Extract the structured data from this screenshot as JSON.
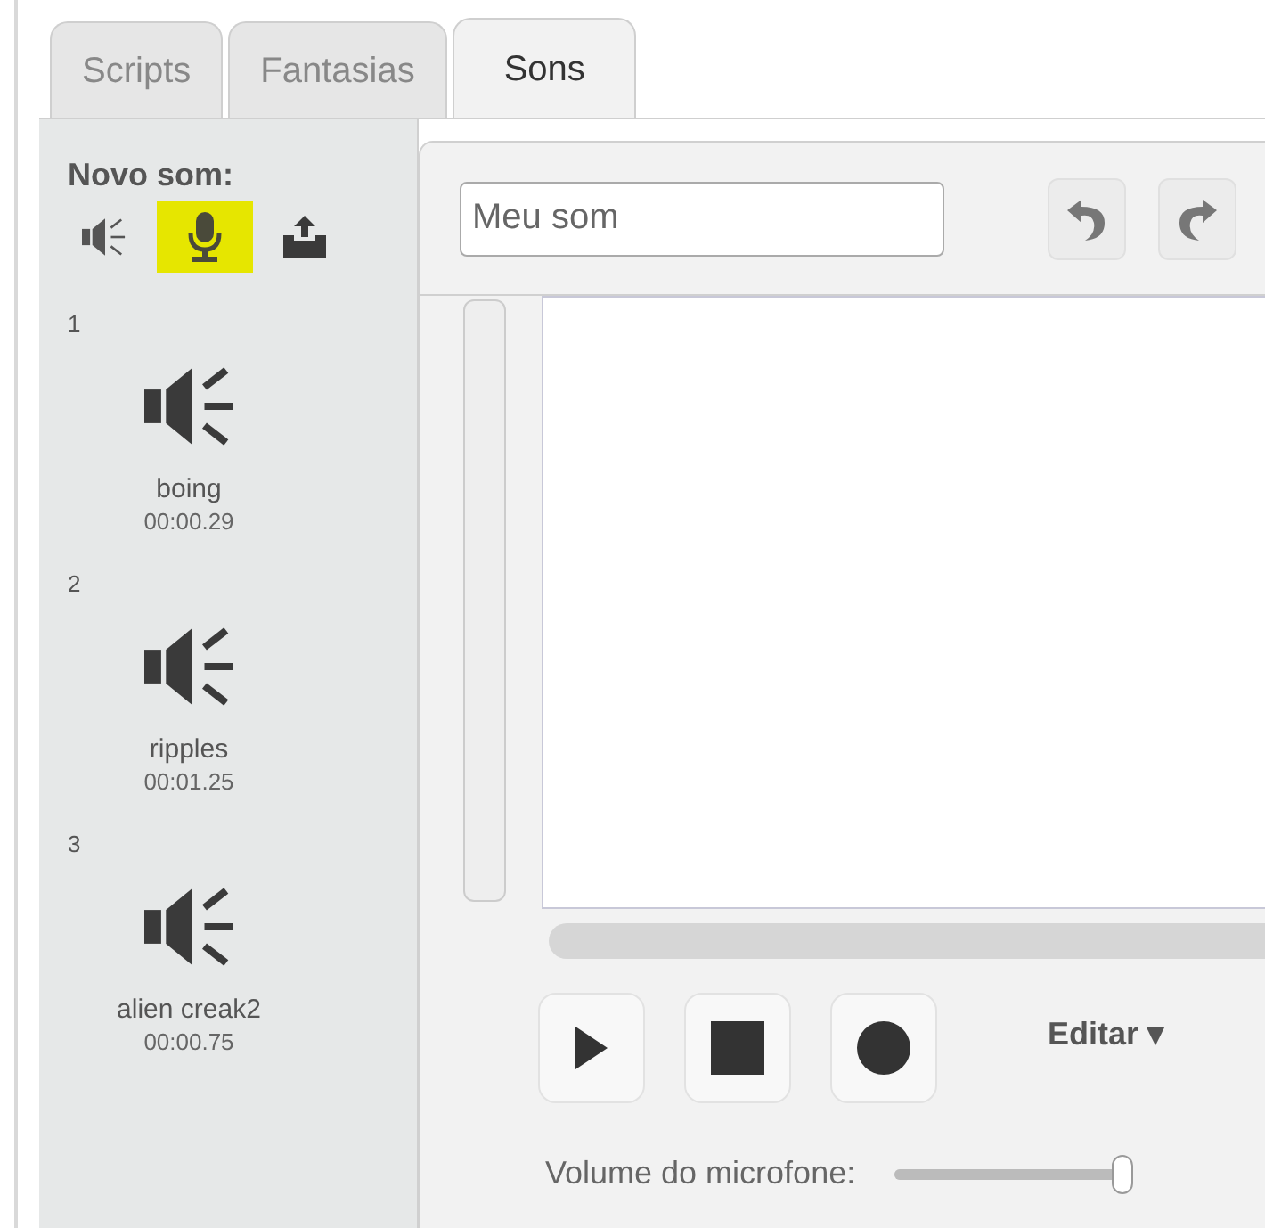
{
  "tabs": [
    {
      "label": "Scripts",
      "selected": false
    },
    {
      "label": "Fantasias",
      "selected": false
    },
    {
      "label": "Sons",
      "selected": true
    }
  ],
  "new_sound": {
    "label": "Novo som:",
    "buttons": [
      {
        "kind": "library",
        "selected": false
      },
      {
        "kind": "record",
        "selected": true
      },
      {
        "kind": "upload",
        "selected": false
      }
    ]
  },
  "sounds": [
    {
      "number": "1",
      "name": "boing",
      "duration": "00:00.29"
    },
    {
      "number": "2",
      "name": "ripples",
      "duration": "00:01.25"
    },
    {
      "number": "3",
      "name": "alien creak2",
      "duration": "00:00.75"
    }
  ],
  "editor": {
    "name_field": {
      "value": "Meu som"
    },
    "edit_menu": "Editar ▾",
    "volume": {
      "label": "Volume do microfone:",
      "level": 1
    }
  }
}
